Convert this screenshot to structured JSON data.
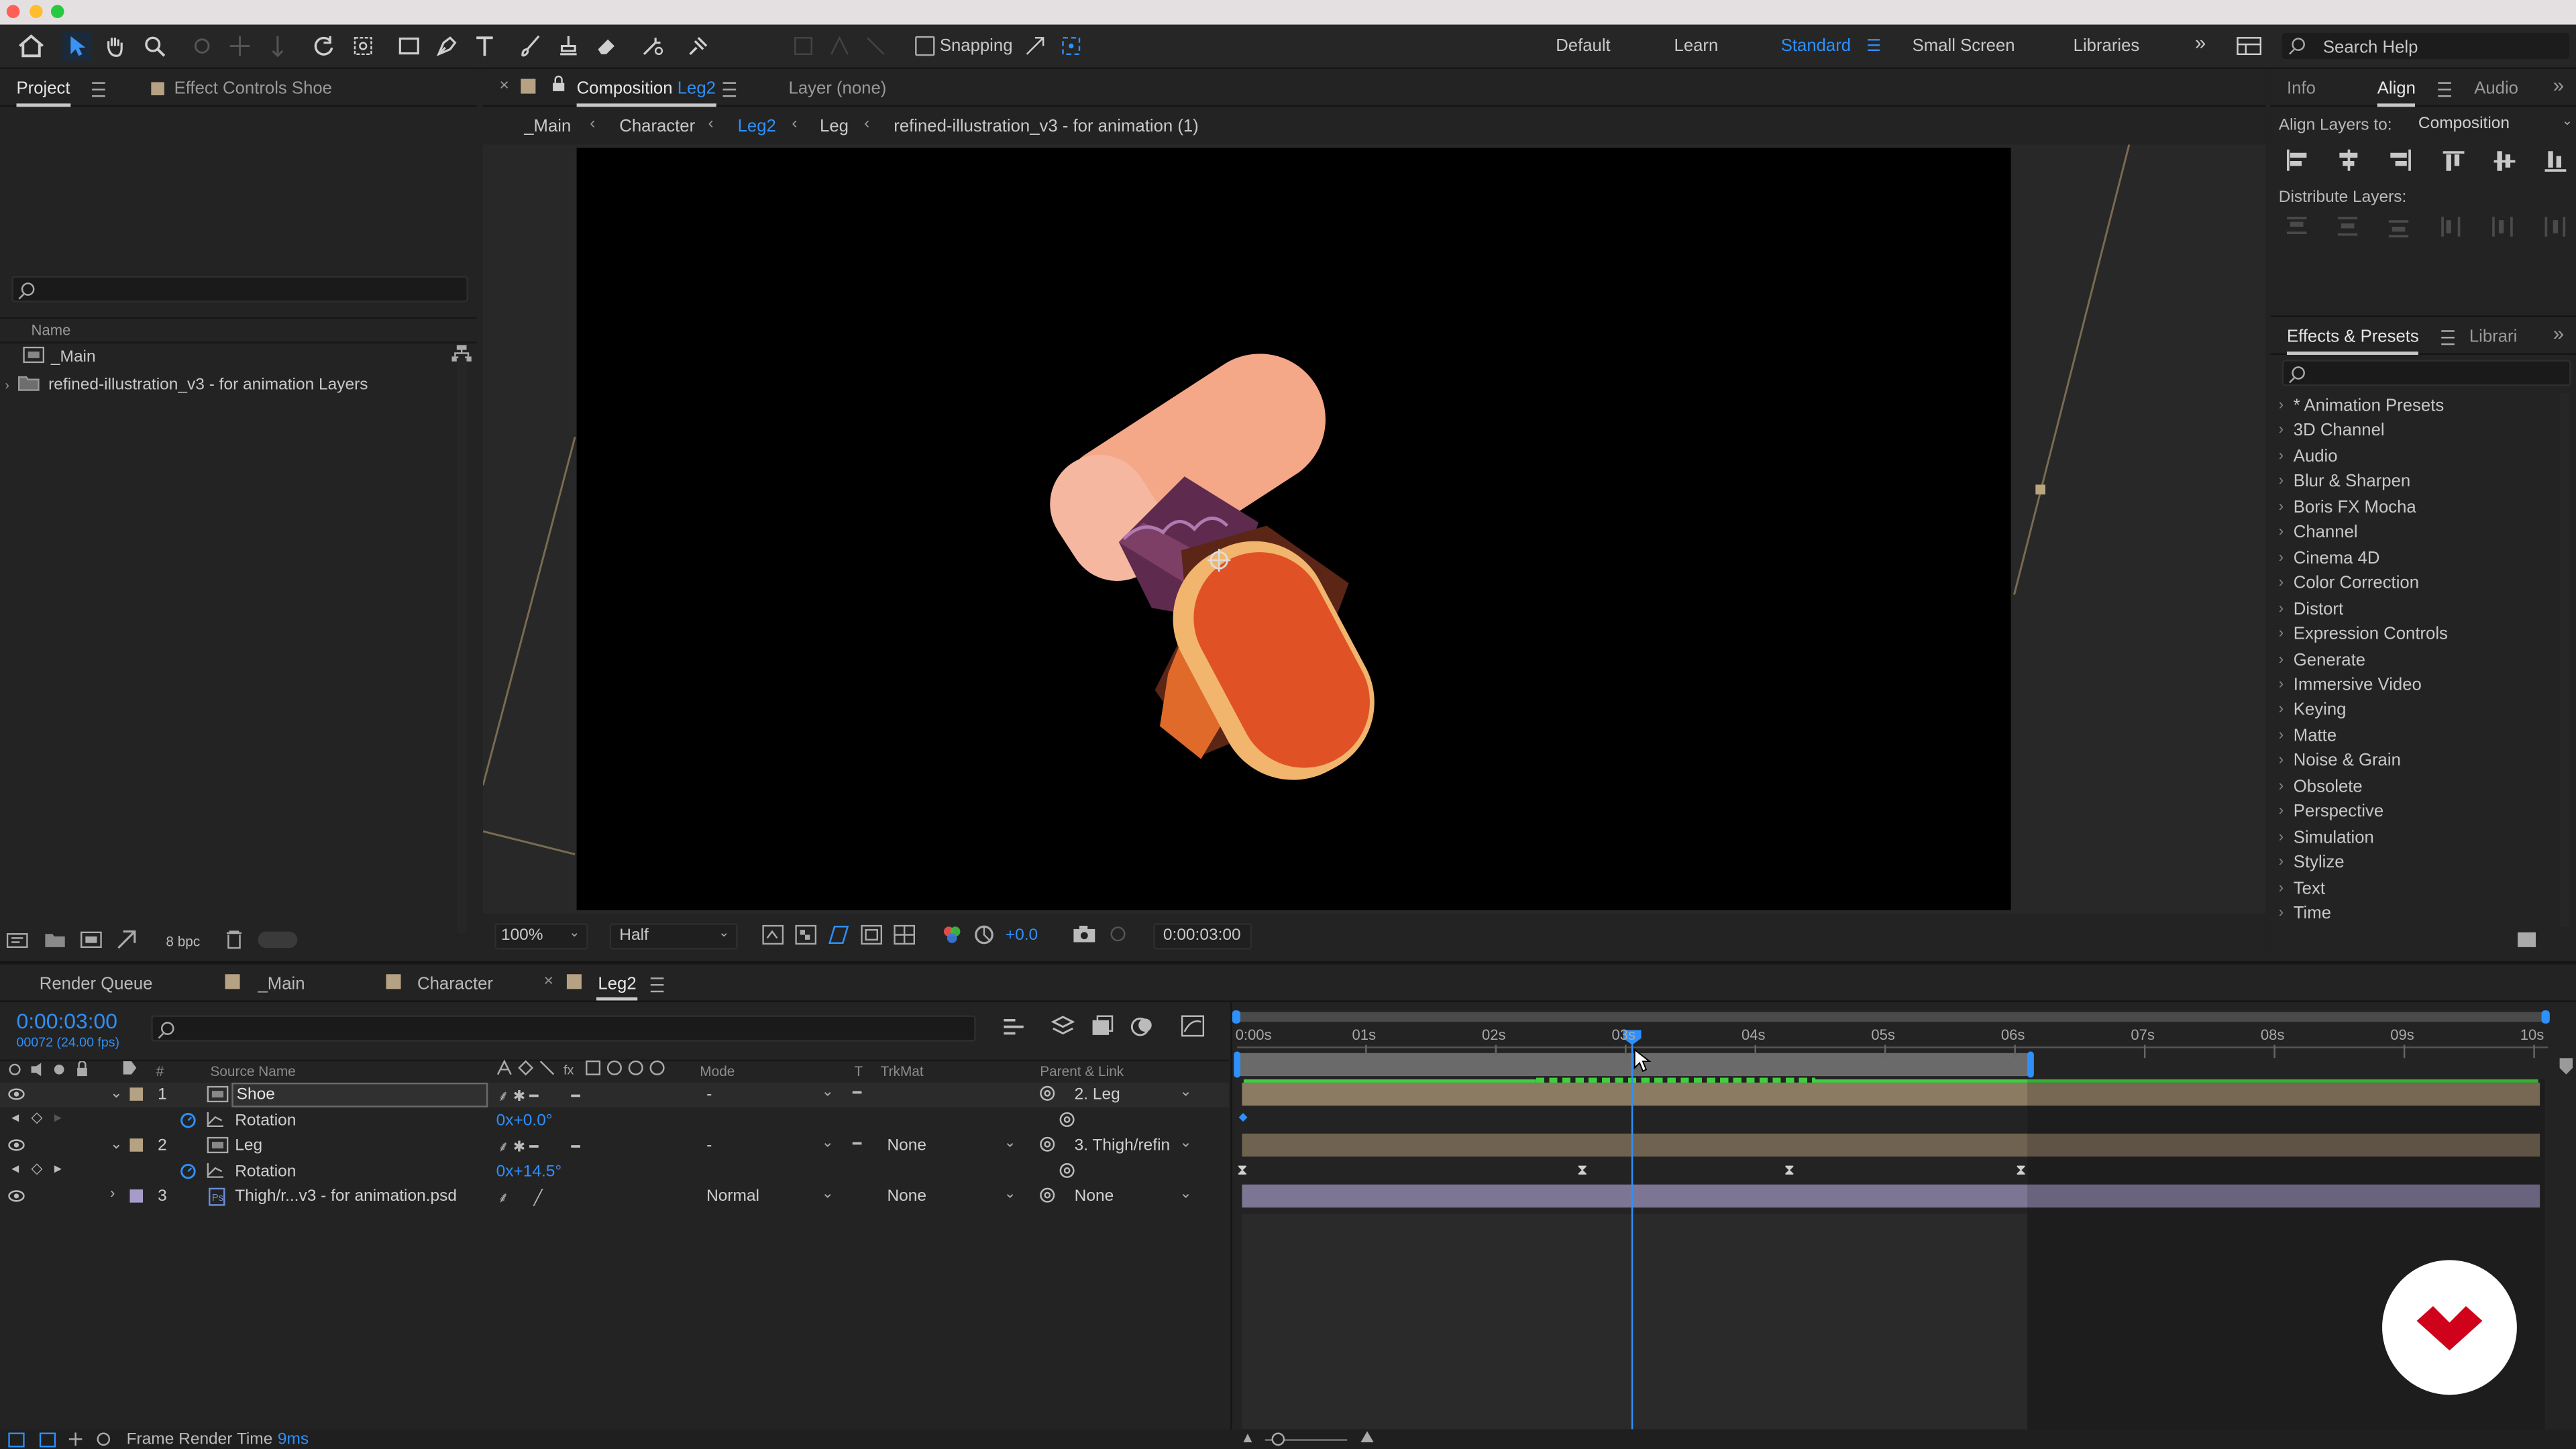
{
  "colors": {
    "accent": "#2e90fa",
    "label_tan": "#b5a283",
    "label_lavender": "#a79cc9",
    "track_green": "#3fcf3f",
    "logo_red": "#d0021b",
    "button_close": "#ff5f57",
    "button_min": "#febc2e",
    "button_max": "#28c840"
  },
  "toolbar": {
    "snapping_label": "Snapping",
    "workspaces": [
      "Default",
      "Learn",
      "Standard",
      "Small Screen",
      "Libraries"
    ],
    "active_workspace": "Standard",
    "more": "»",
    "search_help": "Search Help"
  },
  "project_panel": {
    "tab_project": "Project",
    "tab_effect_controls": "Effect Controls Shoe",
    "column_name": "Name",
    "items": [
      "_Main",
      "refined-illustration_v3 - for animation Layers"
    ],
    "bpc": "8 bpc"
  },
  "composition_panel": {
    "tab_prefix": "Composition",
    "tab_comp_name": "Leg2",
    "tab_layer": "Layer (none)",
    "breadcrumbs": [
      "_Main",
      "Character",
      "Leg2",
      "Leg",
      "refined-illustration_v3 - for animation (1)"
    ],
    "active_breadcrumb": "Leg2",
    "zoom": "100%",
    "resolution": "Half",
    "exposure": "+0.0",
    "timecode": "0:00:03:00"
  },
  "right_panel": {
    "tabs_top": [
      "Info",
      "Align",
      "Audio"
    ],
    "active_top": "Align",
    "align_layers_to_label": "Align Layers to:",
    "align_layers_to_value": "Composition",
    "distribute_label": "Distribute Layers:",
    "tabs_fx": [
      "Effects & Presets",
      "Librari"
    ],
    "effects": [
      "* Animation Presets",
      "3D Channel",
      "Audio",
      "Blur & Sharpen",
      "Boris FX Mocha",
      "Channel",
      "Cinema 4D",
      "Color Correction",
      "Distort",
      "Expression Controls",
      "Generate",
      "Immersive Video",
      "Keying",
      "Matte",
      "Noise & Grain",
      "Obsolete",
      "Perspective",
      "Simulation",
      "Stylize",
      "Text",
      "Time"
    ]
  },
  "timeline": {
    "tabs": [
      "Render Queue",
      "_Main",
      "Character",
      "Leg2"
    ],
    "active_tab": "Leg2",
    "timecode": "0:00:03:00",
    "frame_info": "00072 (24.00 fps)",
    "columns": {
      "number": "#",
      "source_name": "Source Name",
      "mode": "Mode",
      "t": "T",
      "trkmat": "TrkMat",
      "parent": "Parent & Link"
    },
    "ruler_labels": [
      "0:00s",
      "01s",
      "02s",
      "03s",
      "04s",
      "05s",
      "06s",
      "07s",
      "08s",
      "09s",
      "10s"
    ],
    "layers": [
      {
        "num": "1",
        "name": "Shoe",
        "mode": "-",
        "trkmat": "",
        "parent": "2. Leg",
        "prop": "Rotation",
        "prop_value": "0x+0.0°"
      },
      {
        "num": "2",
        "name": "Leg",
        "mode": "-",
        "trkmat": "None",
        "parent": "3. Thigh/refin",
        "prop": "Rotation",
        "prop_value": "0x+14.5°"
      },
      {
        "num": "3",
        "name": "Thigh/r...v3 - for animation.psd",
        "mode": "Normal",
        "trkmat": "None",
        "parent": "None"
      }
    ]
  },
  "status": {
    "frame_render_label": "Frame Render Time",
    "frame_render_value": "9ms"
  }
}
